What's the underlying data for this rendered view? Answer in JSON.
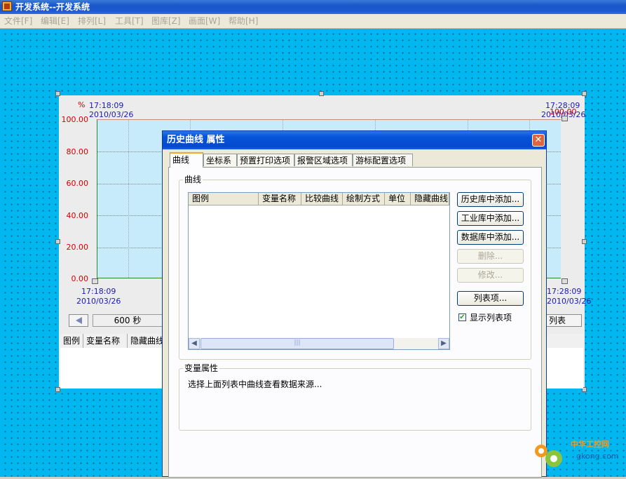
{
  "window": {
    "title": "开发系统--开发系统"
  },
  "menu": [
    {
      "label": "文件[F]"
    },
    {
      "label": "编辑[E]"
    },
    {
      "label": "排列[L]"
    },
    {
      "label": "工具[T]"
    },
    {
      "label": "图库[Z]"
    },
    {
      "label": "画面[W]"
    },
    {
      "label": "帮助[H]"
    }
  ],
  "chart": {
    "unit": "%",
    "top_left_time": "17:18:09",
    "top_left_date": "2010/03/26",
    "top_right_time": "17:28:09",
    "top_right_date": "2010/03/26",
    "top_right_value": "100.00",
    "bottom_left_time": "17:18:09",
    "bottom_left_date": "2010/03/26",
    "bottom_right_time": "17:28:09",
    "bottom_right_date": "2010/03/26",
    "y_ticks": [
      "100.00",
      "80.00",
      "60.00",
      "40.00",
      "20.00",
      "0.00"
    ],
    "span_label": "600  秒",
    "list_button": "列表",
    "legend_columns": [
      "图例",
      "变量名称",
      "隐藏曲线"
    ]
  },
  "dialog": {
    "title": "历史曲线 属性",
    "close_glyph": "✕",
    "tabs": [
      "曲线",
      "坐标系",
      "预置打印选项",
      "报警区域选项",
      "游标配置选项"
    ],
    "active_tab": 0,
    "curve_group": {
      "title": "曲线",
      "columns": [
        "图例",
        "变量名称",
        "比较曲线",
        "绘制方式",
        "单位",
        "隐藏曲线"
      ],
      "rows": []
    },
    "buttons": [
      {
        "label": "历史库中添加...",
        "enabled": true
      },
      {
        "label": "工业库中添加...",
        "enabled": true
      },
      {
        "label": "数据库中添加...",
        "enabled": true
      },
      {
        "label": "删除...",
        "enabled": false
      },
      {
        "label": "修改...",
        "enabled": false
      },
      {
        "label": "列表项...",
        "enabled": true
      }
    ],
    "show_list_checkbox": {
      "label": "显示列表项",
      "checked": true,
      "glyph": "✔"
    },
    "var_group": {
      "title": "变量属性",
      "text": "选择上面列表中曲线查看数据来源..."
    }
  },
  "watermark": {
    "text": "中华工控网",
    "url": "gkong.com"
  },
  "colors": {
    "canvas": "#00b7ef",
    "plot": "#c7ebfa",
    "axis_red": "#d20000",
    "time_blue": "#1b1baf"
  }
}
